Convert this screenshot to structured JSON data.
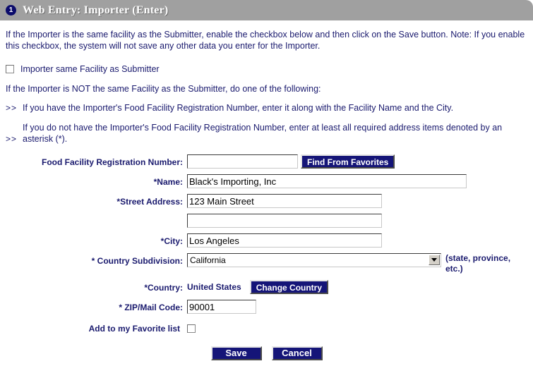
{
  "header": {
    "step_number": "1",
    "title": "Web Entry: Importer (Enter)"
  },
  "intro": {
    "paragraph": "If the Importer is the same facility as the Submitter, enable the checkbox below and then click on the Save button. Note: If you enable this checkbox, the system will not save any other data you enter for the Importer.",
    "same_facility_checkbox_label": "Importer same Facility as Submitter",
    "not_same_heading": "If the Importer is NOT the same Facility as the Submitter, do one of the following:",
    "bullet_marker": ">>",
    "bullet_one": "If you have the Importer's Food Facility Registration Number, enter it along with the Facility Name and the City.",
    "bullet_two": "If you do not have the Importer's Food Facility Registration Number, enter at least all required address items denoted by an asterisk (*)."
  },
  "form": {
    "ffrn": {
      "label": "Food Facility Registration Number:",
      "value": "",
      "placeholder": ""
    },
    "find_favorites_button": "Find From Favorites",
    "name": {
      "label": "*Name:",
      "value": "Black's Importing, Inc",
      "placeholder": ""
    },
    "street_address": {
      "label": "*Street Address:",
      "value": "123 Main Street",
      "placeholder": ""
    },
    "street_address_2": {
      "label": "",
      "value": "",
      "placeholder": ""
    },
    "city": {
      "label": "*City:",
      "value": "Los Angeles",
      "placeholder": ""
    },
    "country_subdivision": {
      "label": "* Country Subdivision:",
      "selected": "California",
      "hint": "(state, province, etc.)"
    },
    "country": {
      "label": "*Country:",
      "value": "United States",
      "change_button": "Change Country"
    },
    "zip": {
      "label": "* ZIP/Mail Code:",
      "value": "90001",
      "placeholder": ""
    },
    "favorite": {
      "label": "Add to my Favorite list"
    }
  },
  "actions": {
    "save": "Save",
    "cancel": "Cancel"
  },
  "colors": {
    "header_bar": "#a0a0a0",
    "badge": "#0b0b6b",
    "text": "#1a1a6e",
    "button_navy": "#151578"
  }
}
